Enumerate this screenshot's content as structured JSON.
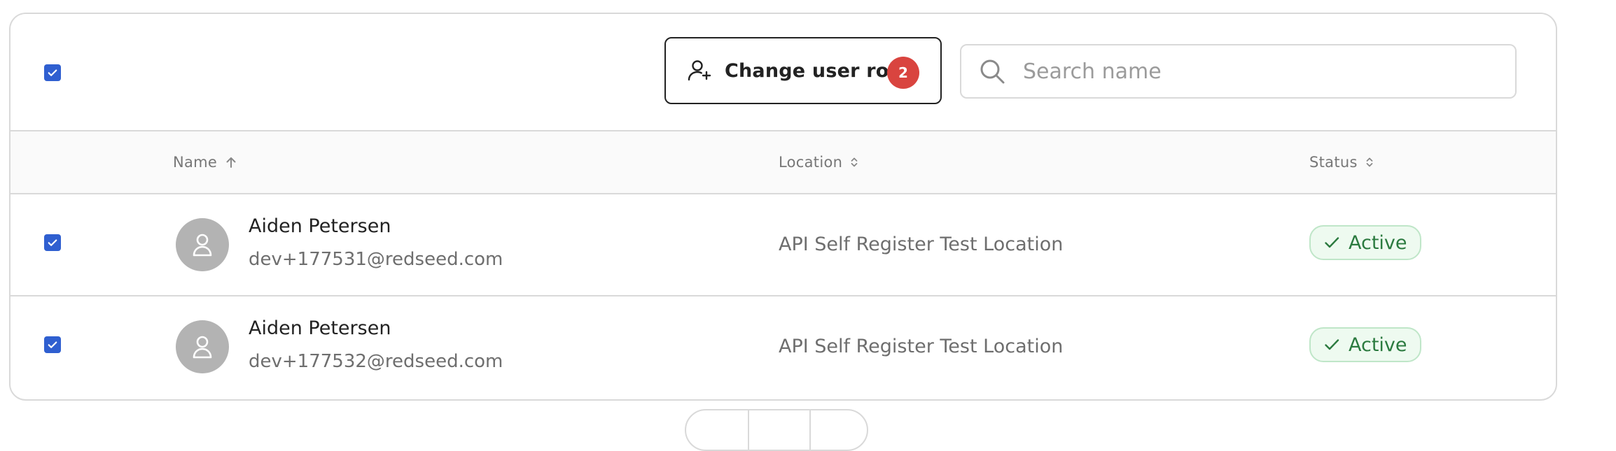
{
  "toolbar": {
    "change_role_label": "Change user role",
    "selected_count": "2",
    "search_placeholder": "Search name"
  },
  "table": {
    "columns": {
      "name": "Name",
      "location": "Location",
      "status": "Status"
    },
    "rows": [
      {
        "name": "Aiden Petersen",
        "email": "dev+177531@redseed.com",
        "location": "API Self Register Test Location",
        "status": "Active",
        "selected": true
      },
      {
        "name": "Aiden Petersen",
        "email": "dev+177532@redseed.com",
        "location": "API Self Register Test Location",
        "status": "Active",
        "selected": true
      }
    ]
  },
  "icons": {
    "checkbox": "check-icon",
    "change_role": "user-plus-icon",
    "search": "search-icon",
    "sort_name": "arrow-up-icon",
    "sort_other": "sort-icon",
    "avatar": "user-icon",
    "status": "check-icon"
  },
  "colors": {
    "accent": "#2f5fd0",
    "badge": "#d9443f",
    "status_text": "#2b7a3f",
    "status_bg": "#eefaf0",
    "status_border": "#bfe6c8"
  }
}
